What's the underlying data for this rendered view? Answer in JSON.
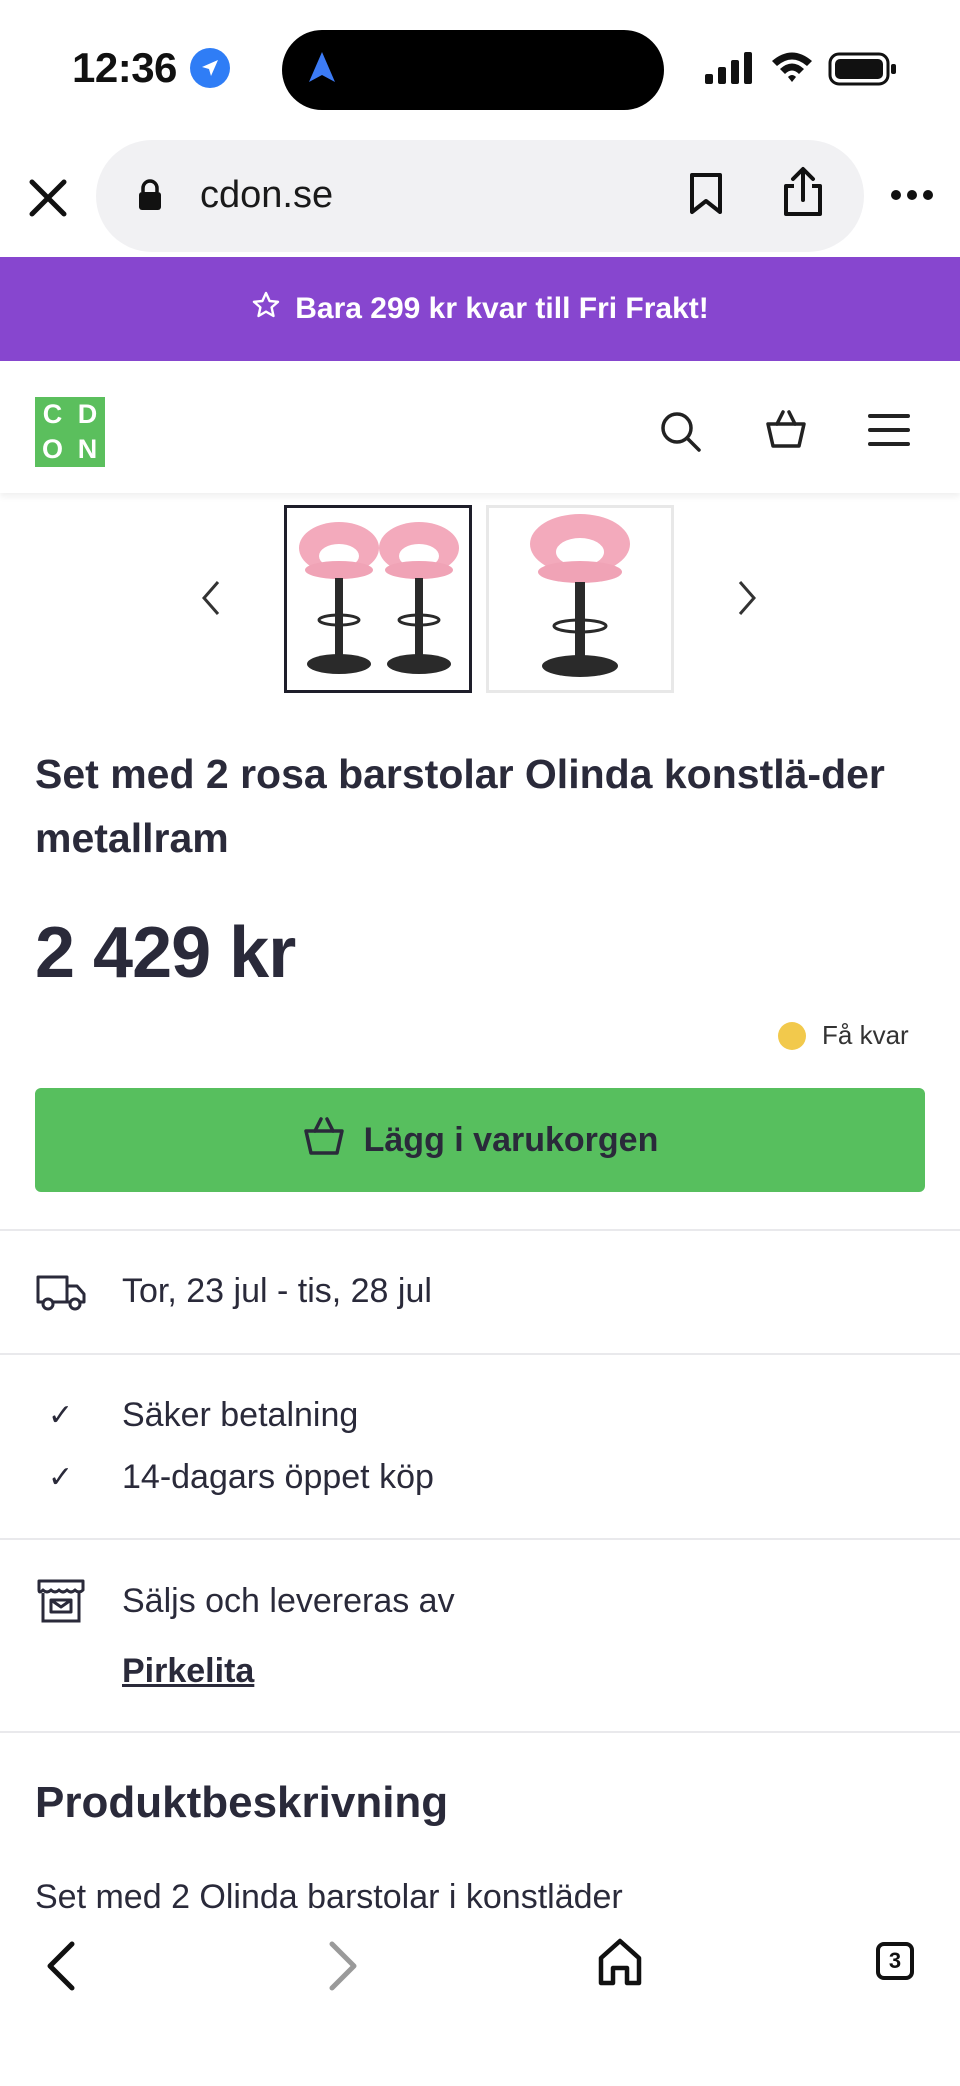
{
  "status_bar": {
    "time": "12:36"
  },
  "browser": {
    "url": "cdon.se",
    "tab_count": "3"
  },
  "promo": {
    "text": "Bara 299 kr kvar till Fri Frakt!"
  },
  "logo": {
    "letters": [
      "C",
      "D",
      "O",
      "N"
    ]
  },
  "product": {
    "title": "Set med 2 rosa barstolar Olinda konstlä-der metallram",
    "price": "2 429 kr",
    "stock": "Få kvar",
    "add_to_cart": "Lägg i varukorgen",
    "delivery": "Tor, 23 jul - tis, 28 jul",
    "features": [
      "Säker betalning",
      "14-dagars öppet köp"
    ],
    "seller_label": "Säljs och levereras av",
    "seller": "Pirkelita",
    "description_heading": "Produktbeskrivning",
    "description": "Set med 2 Olinda barstolar i konstläder"
  },
  "colors": {
    "promo": "#8746cf",
    "add_to_cart": "#57bf5e",
    "logo": "#5bbf5d",
    "stock_dot": "#f2c94c",
    "chair_pink": "#f3aabc"
  }
}
